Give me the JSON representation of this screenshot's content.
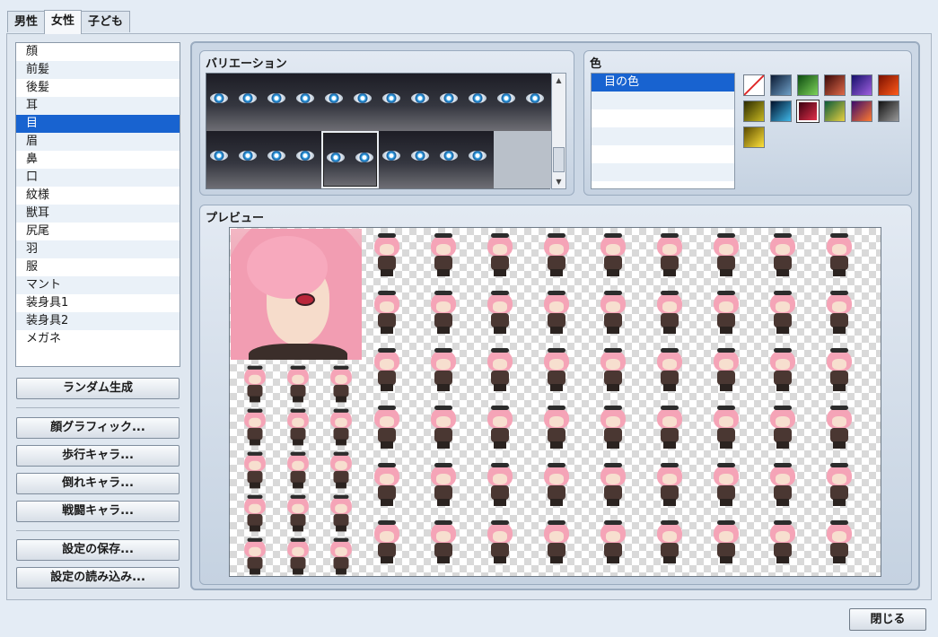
{
  "tabs": [
    {
      "label": "男性",
      "active": false
    },
    {
      "label": "女性",
      "active": true
    },
    {
      "label": "子ども",
      "active": false
    }
  ],
  "parts": {
    "items": [
      "顔",
      "前髪",
      "後髪",
      "耳",
      "目",
      "眉",
      "鼻",
      "口",
      "紋様",
      "獣耳",
      "尻尾",
      "羽",
      "服",
      "マント",
      "装身具1",
      "装身具2",
      "メガネ"
    ],
    "selected": "目"
  },
  "buttons": {
    "random": "ランダム生成",
    "face_graphic": "顔グラフィック...",
    "walk_char": "歩行キャラ...",
    "damage_char": "倒れキャラ...",
    "battle_char": "戦闘キャラ...",
    "save_settings": "設定の保存...",
    "load_settings": "設定の読み込み...",
    "close": "閉じる"
  },
  "variation": {
    "title": "バリエーション",
    "thumb_count": 11,
    "selected_index": 8
  },
  "color": {
    "title": "色",
    "rows": [
      "目の色",
      "",
      "",
      "",
      "",
      ""
    ],
    "selected_row": "目の色",
    "swatches": [
      "none",
      "linear-gradient(135deg,#0b1a33,#6fa0c8)",
      "linear-gradient(135deg,#0c4a10,#7ed35a)",
      "linear-gradient(135deg,#3a0808,#e06a4a)",
      "linear-gradient(135deg,#14106a,#a160e0)",
      "linear-gradient(135deg,#7a1000,#ff5a1a)",
      "linear-gradient(135deg,#2a2a00,#c8b820)",
      "linear-gradient(135deg,#00102a,#40b8e8)",
      "linear-gradient(135deg,#3a0010,#e0304a)",
      "linear-gradient(135deg,#0a5a3a,#e8d040)",
      "linear-gradient(135deg,#3a0a6a,#ff7a30)",
      "linear-gradient(135deg,#111111,#9a9a9a)",
      "linear-gradient(135deg,#5a4a00,#ffe23a)"
    ],
    "selected_swatch": 8
  },
  "preview": {
    "title": "プレビュー"
  }
}
